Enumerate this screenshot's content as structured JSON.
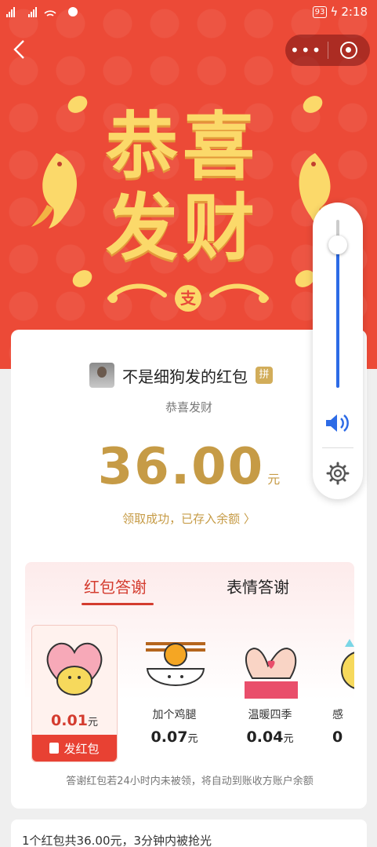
{
  "status_bar": {
    "signal_left": "4G 5G",
    "battery": "93",
    "time": "2:18"
  },
  "header": {
    "back_icon": "chevron-left-icon",
    "more_label": "•••",
    "banner_text": "恭喜发财",
    "logo_char": "支"
  },
  "card": {
    "sender_name": "不是细狗发的红包",
    "pin_badge": "拼",
    "greeting": "恭喜发财",
    "amount": "36.00",
    "unit": "元",
    "received_text": "领取成功，已存入余额 〉"
  },
  "thanks": {
    "tabs": [
      {
        "label": "红包答谢",
        "active": true
      },
      {
        "label": "表情答谢",
        "active": false
      }
    ],
    "stickers": [
      {
        "label": "",
        "price": "0.01",
        "unit": "元",
        "selected": true
      },
      {
        "label": "加个鸡腿",
        "price": "0.07",
        "unit": "元",
        "selected": false
      },
      {
        "label": "温暖四季",
        "price": "0.04",
        "unit": "元",
        "selected": false
      },
      {
        "label": "感",
        "price": "0",
        "unit": "",
        "selected": false
      }
    ],
    "send_button": "发红包",
    "note": "答谢红包若24小时内未被领，将自动到账收方账户余额"
  },
  "volume": {
    "level": 0.85
  },
  "summary": {
    "text": "1个红包共36.00元，3分钟内被抢光"
  },
  "colors": {
    "header_red": "#ec4a37",
    "gold": "#c69b46",
    "accent_red": "#d43c2f",
    "volume_blue": "#2d6be6"
  }
}
